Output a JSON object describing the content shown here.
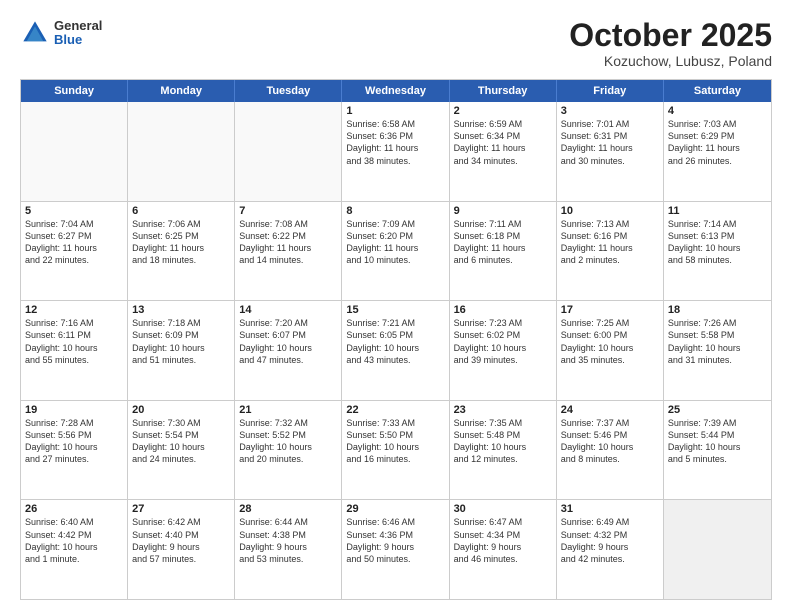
{
  "header": {
    "logo": {
      "general": "General",
      "blue": "Blue"
    },
    "title": "October 2025",
    "location": "Kozuchow, Lubusz, Poland"
  },
  "weekdays": [
    "Sunday",
    "Monday",
    "Tuesday",
    "Wednesday",
    "Thursday",
    "Friday",
    "Saturday"
  ],
  "rows": [
    [
      {
        "day": "",
        "text": "",
        "empty": true
      },
      {
        "day": "",
        "text": "",
        "empty": true
      },
      {
        "day": "",
        "text": "",
        "empty": true
      },
      {
        "day": "1",
        "text": "Sunrise: 6:58 AM\nSunset: 6:36 PM\nDaylight: 11 hours\nand 38 minutes."
      },
      {
        "day": "2",
        "text": "Sunrise: 6:59 AM\nSunset: 6:34 PM\nDaylight: 11 hours\nand 34 minutes."
      },
      {
        "day": "3",
        "text": "Sunrise: 7:01 AM\nSunset: 6:31 PM\nDaylight: 11 hours\nand 30 minutes."
      },
      {
        "day": "4",
        "text": "Sunrise: 7:03 AM\nSunset: 6:29 PM\nDaylight: 11 hours\nand 26 minutes."
      }
    ],
    [
      {
        "day": "5",
        "text": "Sunrise: 7:04 AM\nSunset: 6:27 PM\nDaylight: 11 hours\nand 22 minutes."
      },
      {
        "day": "6",
        "text": "Sunrise: 7:06 AM\nSunset: 6:25 PM\nDaylight: 11 hours\nand 18 minutes."
      },
      {
        "day": "7",
        "text": "Sunrise: 7:08 AM\nSunset: 6:22 PM\nDaylight: 11 hours\nand 14 minutes."
      },
      {
        "day": "8",
        "text": "Sunrise: 7:09 AM\nSunset: 6:20 PM\nDaylight: 11 hours\nand 10 minutes."
      },
      {
        "day": "9",
        "text": "Sunrise: 7:11 AM\nSunset: 6:18 PM\nDaylight: 11 hours\nand 6 minutes."
      },
      {
        "day": "10",
        "text": "Sunrise: 7:13 AM\nSunset: 6:16 PM\nDaylight: 11 hours\nand 2 minutes."
      },
      {
        "day": "11",
        "text": "Sunrise: 7:14 AM\nSunset: 6:13 PM\nDaylight: 10 hours\nand 58 minutes."
      }
    ],
    [
      {
        "day": "12",
        "text": "Sunrise: 7:16 AM\nSunset: 6:11 PM\nDaylight: 10 hours\nand 55 minutes."
      },
      {
        "day": "13",
        "text": "Sunrise: 7:18 AM\nSunset: 6:09 PM\nDaylight: 10 hours\nand 51 minutes."
      },
      {
        "day": "14",
        "text": "Sunrise: 7:20 AM\nSunset: 6:07 PM\nDaylight: 10 hours\nand 47 minutes."
      },
      {
        "day": "15",
        "text": "Sunrise: 7:21 AM\nSunset: 6:05 PM\nDaylight: 10 hours\nand 43 minutes."
      },
      {
        "day": "16",
        "text": "Sunrise: 7:23 AM\nSunset: 6:02 PM\nDaylight: 10 hours\nand 39 minutes."
      },
      {
        "day": "17",
        "text": "Sunrise: 7:25 AM\nSunset: 6:00 PM\nDaylight: 10 hours\nand 35 minutes."
      },
      {
        "day": "18",
        "text": "Sunrise: 7:26 AM\nSunset: 5:58 PM\nDaylight: 10 hours\nand 31 minutes."
      }
    ],
    [
      {
        "day": "19",
        "text": "Sunrise: 7:28 AM\nSunset: 5:56 PM\nDaylight: 10 hours\nand 27 minutes."
      },
      {
        "day": "20",
        "text": "Sunrise: 7:30 AM\nSunset: 5:54 PM\nDaylight: 10 hours\nand 24 minutes."
      },
      {
        "day": "21",
        "text": "Sunrise: 7:32 AM\nSunset: 5:52 PM\nDaylight: 10 hours\nand 20 minutes."
      },
      {
        "day": "22",
        "text": "Sunrise: 7:33 AM\nSunset: 5:50 PM\nDaylight: 10 hours\nand 16 minutes."
      },
      {
        "day": "23",
        "text": "Sunrise: 7:35 AM\nSunset: 5:48 PM\nDaylight: 10 hours\nand 12 minutes."
      },
      {
        "day": "24",
        "text": "Sunrise: 7:37 AM\nSunset: 5:46 PM\nDaylight: 10 hours\nand 8 minutes."
      },
      {
        "day": "25",
        "text": "Sunrise: 7:39 AM\nSunset: 5:44 PM\nDaylight: 10 hours\nand 5 minutes."
      }
    ],
    [
      {
        "day": "26",
        "text": "Sunrise: 6:40 AM\nSunset: 4:42 PM\nDaylight: 10 hours\nand 1 minute."
      },
      {
        "day": "27",
        "text": "Sunrise: 6:42 AM\nSunset: 4:40 PM\nDaylight: 9 hours\nand 57 minutes."
      },
      {
        "day": "28",
        "text": "Sunrise: 6:44 AM\nSunset: 4:38 PM\nDaylight: 9 hours\nand 53 minutes."
      },
      {
        "day": "29",
        "text": "Sunrise: 6:46 AM\nSunset: 4:36 PM\nDaylight: 9 hours\nand 50 minutes."
      },
      {
        "day": "30",
        "text": "Sunrise: 6:47 AM\nSunset: 4:34 PM\nDaylight: 9 hours\nand 46 minutes."
      },
      {
        "day": "31",
        "text": "Sunrise: 6:49 AM\nSunset: 4:32 PM\nDaylight: 9 hours\nand 42 minutes."
      },
      {
        "day": "",
        "text": "",
        "empty": true,
        "shaded": true
      }
    ]
  ]
}
